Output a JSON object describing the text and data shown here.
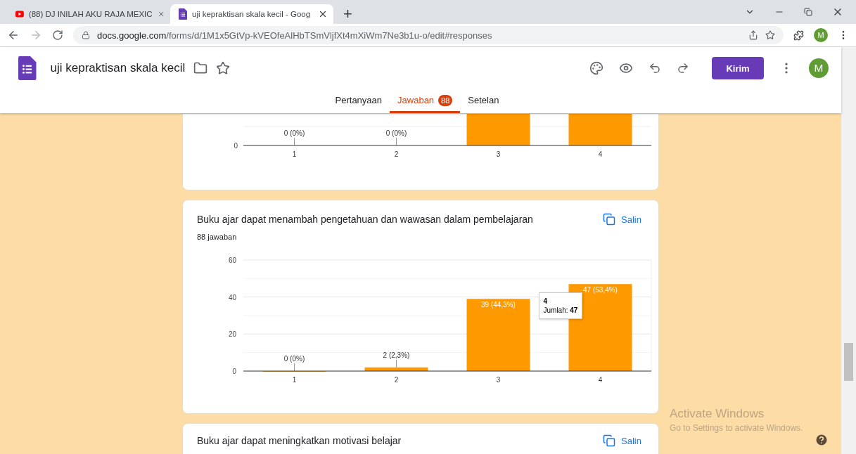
{
  "browser": {
    "tabs": [
      {
        "title": "(88) DJ INILAH AKU RAJA MEXIC",
        "selected": false,
        "kind": "video"
      },
      {
        "title": "uji kepraktisan skala kecil - Goog",
        "selected": true,
        "kind": "form"
      }
    ],
    "new_tab": "+",
    "url": {
      "host": "docs.google.com",
      "path": "/forms/d/1M1x5GtVp-kVEOfeAlHbTSmVljfXt4mXiWm7Ne3b1u-o/edit#responses"
    },
    "profile": "M"
  },
  "form_header": {
    "title": "uji kepraktisan skala kecil",
    "send_button": "Kirim",
    "avatar": "M",
    "tabs": [
      {
        "label": "Pertanyaan",
        "selected": false
      },
      {
        "label": "Jawaban",
        "selected": true,
        "badge": "88"
      },
      {
        "label": "Setelan",
        "selected": false
      }
    ]
  },
  "cards": [
    {
      "kind": "chart_tail",
      "ytick": "0",
      "bars": [
        {
          "category": "1",
          "label": "0 (0%)",
          "kind": "empty"
        },
        {
          "category": "2",
          "label": "0 (0%)",
          "kind": "empty"
        },
        {
          "category": "3",
          "kind": "cut"
        },
        {
          "category": "4",
          "kind": "cut"
        }
      ]
    },
    {
      "kind": "chart",
      "title": "Buku ajar dapat menambah pengetahuan dan wawasan dalam pembelajaran",
      "copy_button": "Salin",
      "responses": "88 jawaban",
      "chart_data": {
        "type": "bar",
        "categories": [
          "1",
          "2",
          "3",
          "4"
        ],
        "series": [
          {
            "color": "#ff9900",
            "values": [
              0,
              2,
              39,
              47
            ]
          }
        ],
        "ylim": [
          0,
          60
        ],
        "yticks": [
          0,
          20,
          40,
          60
        ],
        "value_labels": [
          "0 (0%)",
          "2 (2,3%)",
          "39 (44,3%)",
          "47 (53,4%)"
        ]
      },
      "tooltip": {
        "category": "4",
        "text": "Jumlah: **47**"
      }
    },
    {
      "kind": "heading",
      "title": "Buku ajar dapat meningkatkan motivasi belajar",
      "copy_button": "Salin"
    }
  ],
  "activation": {
    "title": "Activate Windows",
    "hint": "Go to Settings to activate Windows."
  }
}
